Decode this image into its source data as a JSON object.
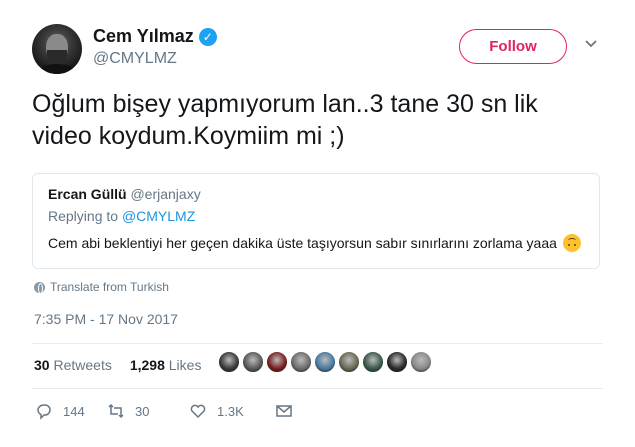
{
  "author": {
    "display_name": "Cem Yılmaz",
    "handle": "@CMYLMZ",
    "verified_icon": "verified-badge-icon"
  },
  "follow_button": {
    "label": "Follow"
  },
  "tweet": {
    "text": "Oğlum bişey yapmıyorum lan..3 tane 30 sn lik video koydum.Koymiim mi ;)"
  },
  "quoted_tweet": {
    "name": "Ercan Güllü",
    "handle": "@erjanjaxy",
    "replying_prefix": "Replying to",
    "replying_handle": "@CMYLMZ",
    "text": "Cem abi beklentiyi her geçen dakika üste taşıyorsun sabır sınırlarını zorlama yaaa",
    "emoji": "upside-down-face-emoji"
  },
  "translate_label": "Translate from Turkish",
  "timestamp": "7:35 PM - 17 Nov 2017",
  "stats": {
    "retweets_count": "30",
    "retweets_label": "Retweets",
    "likes_count": "1,298",
    "likes_label": "Likes"
  },
  "likers_colors": [
    "#3a3a3a",
    "#5a5a5a",
    "#7a2020",
    "#6d6d6d",
    "#4a7aa0",
    "#6a6a55",
    "#3a5a4a",
    "#2a2a2a",
    "#8a8a8a"
  ],
  "actions": {
    "reply_count": "144",
    "retweet_count": "30",
    "like_count": "1.3K"
  },
  "colors": {
    "accent": "#e0245e",
    "link": "#1b95e0",
    "verified": "#1da1f2",
    "muted": "#657786"
  }
}
